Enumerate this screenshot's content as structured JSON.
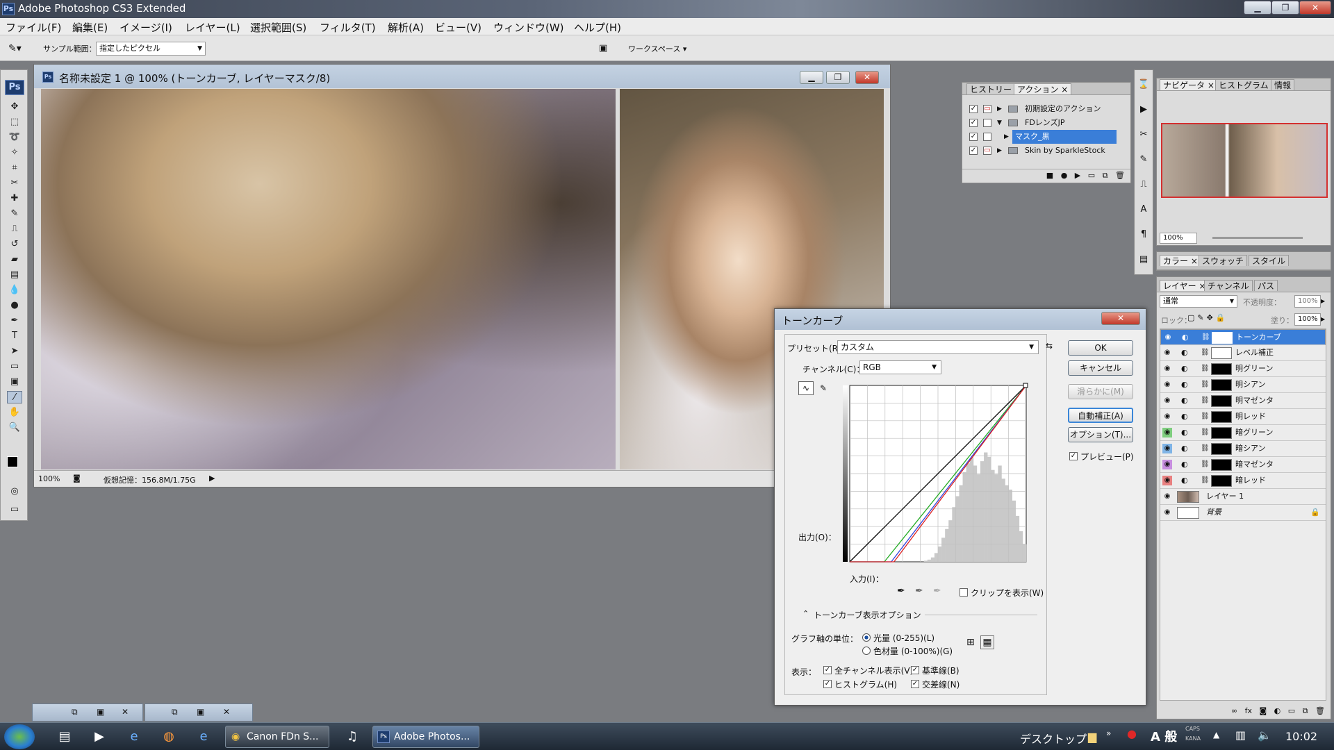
{
  "app": {
    "title": "Adobe Photoshop CS3 Extended",
    "logo": "Ps"
  },
  "window_controls": {
    "minimize": "▁",
    "restore": "❐",
    "close": "✕"
  },
  "menu": [
    "ファイル(F)",
    "編集(E)",
    "イメージ(I)",
    "レイヤー(L)",
    "選択範囲(S)",
    "フィルタ(T)",
    "解析(A)",
    "ビュー(V)",
    "ウィンドウ(W)",
    "ヘルプ(H)"
  ],
  "options": {
    "sample_label": "サンプル範囲：",
    "sample_value": "指定したピクセル",
    "workspace_label": "ワークスペース ▾"
  },
  "document": {
    "title": "名称未設定 1 @ 100% (トーンカーブ, レイヤーマスク/8)",
    "zoom": "100%",
    "memory": "仮想記憶：156.8M/1.75G"
  },
  "actions_panel": {
    "tabs": [
      "ヒストリー",
      "アクション"
    ],
    "items": [
      {
        "label": "初期設定のアクション",
        "kind": "set",
        "open": false
      },
      {
        "label": "FDレンズJP",
        "kind": "set",
        "open": true
      },
      {
        "label": "マスク_黒",
        "kind": "action",
        "selected": true
      },
      {
        "label": "Skin by SparkleStock",
        "kind": "set",
        "open": false
      }
    ]
  },
  "navigator_panel": {
    "tabs": [
      "ナビゲータ",
      "ヒストグラム",
      "情報"
    ],
    "zoom": "100%"
  },
  "color_panel": {
    "tabs": [
      "カラー",
      "スウォッチ",
      "スタイル"
    ]
  },
  "layers_panel": {
    "tabs": [
      "レイヤー",
      "チャンネル",
      "パス"
    ],
    "blend_mode": "通常",
    "opacity_label": "不透明度：",
    "opacity": "100%",
    "lock_label": "ロック：",
    "fill_label": "塗り：",
    "fill": "100%",
    "layers": [
      {
        "name": "トーンカーブ",
        "selected": true,
        "eye_color": "",
        "thumb": "white"
      },
      {
        "name": "レベル補正",
        "selected": false,
        "eye_color": "",
        "thumb": "white"
      },
      {
        "name": "明グリーン",
        "selected": false,
        "eye_color": "",
        "thumb": "black"
      },
      {
        "name": "明シアン",
        "selected": false,
        "eye_color": "",
        "thumb": "black"
      },
      {
        "name": "明マゼンタ",
        "selected": false,
        "eye_color": "",
        "thumb": "black"
      },
      {
        "name": "明レッド",
        "selected": false,
        "eye_color": "",
        "thumb": "black"
      },
      {
        "name": "暗グリーン",
        "selected": false,
        "eye_color": "#7fce7f",
        "thumb": "black"
      },
      {
        "name": "暗シアン",
        "selected": false,
        "eye_color": "#7fb4e6",
        "thumb": "black"
      },
      {
        "name": "暗マゼンタ",
        "selected": false,
        "eye_color": "#c88ee0",
        "thumb": "black"
      },
      {
        "name": "暗レッド",
        "selected": false,
        "eye_color": "#e88080",
        "thumb": "black"
      },
      {
        "name": "レイヤー 1",
        "selected": false,
        "eye_color": "",
        "thumb": "photo"
      },
      {
        "name": "背景",
        "selected": false,
        "eye_color": "",
        "thumb": "white"
      }
    ]
  },
  "curves_dialog": {
    "title": "トーンカーブ",
    "preset_label": "プリセット(R)：",
    "preset_value": "カスタム",
    "channel_label": "チャンネル(C)：",
    "channel_value": "RGB",
    "output_label": "出力(O)：",
    "input_label": "入力(I)：",
    "clip_label": "クリップを表示(W)",
    "options_section": "トーンカーブ表示オプション",
    "graph_unit_label": "グラフ軸の単位：",
    "unit_light": "光量 (0-255)(L)",
    "unit_pigment": "色材量 (0-100%)(G)",
    "show_label": "表示：",
    "show_all_channels": "全チャンネル表示(V)",
    "show_baseline": "基準線(B)",
    "show_histogram": "ヒストグラム(H)",
    "show_intersection": "交差線(N)",
    "buttons": {
      "ok": "OK",
      "cancel": "キャンセル",
      "smooth": "滑らかに(M)",
      "auto": "自動補正(A)",
      "options": "オプション(T)..."
    },
    "preview_label": "プレビュー(P)",
    "preview_checked": true
  },
  "chart_data": {
    "type": "line",
    "title": "",
    "xlabel": "入力(I)：",
    "ylabel": "出力(O)：",
    "xlim": [
      0,
      255
    ],
    "ylim": [
      0,
      255
    ],
    "grid": true,
    "series": [
      {
        "color": "#000000",
        "x": [
          0,
          255
        ],
        "y": [
          0,
          255
        ]
      },
      {
        "color": "#22aa22",
        "x": [
          0,
          50,
          255
        ],
        "y": [
          0,
          0,
          255
        ]
      },
      {
        "color": "#3344dd",
        "x": [
          0,
          60,
          255
        ],
        "y": [
          0,
          0,
          255
        ]
      },
      {
        "color": "#dd2222",
        "x": [
          0,
          64,
          255
        ],
        "y": [
          0,
          0,
          255
        ]
      }
    ],
    "histogram": [
      0,
      0,
      0,
      0,
      0,
      0,
      0,
      0,
      0,
      0,
      0,
      0,
      0,
      0,
      0,
      0,
      0,
      0,
      0,
      0,
      0,
      1,
      2,
      4,
      8,
      14,
      22,
      30,
      38,
      50,
      60,
      70,
      82,
      90,
      95,
      88,
      80,
      92,
      100,
      96,
      84,
      80,
      88,
      76,
      70,
      66,
      56,
      42,
      28,
      16
    ]
  },
  "taskbar": {
    "tasks": [
      {
        "label": "Canon FDn S...",
        "active": false
      },
      {
        "label": "Adobe Photos...",
        "active": true
      }
    ],
    "desktop_label": "デスクトップ",
    "ime": "A 般",
    "clock": "10:02",
    "caps": "CAPS",
    "kana": "KANA"
  }
}
